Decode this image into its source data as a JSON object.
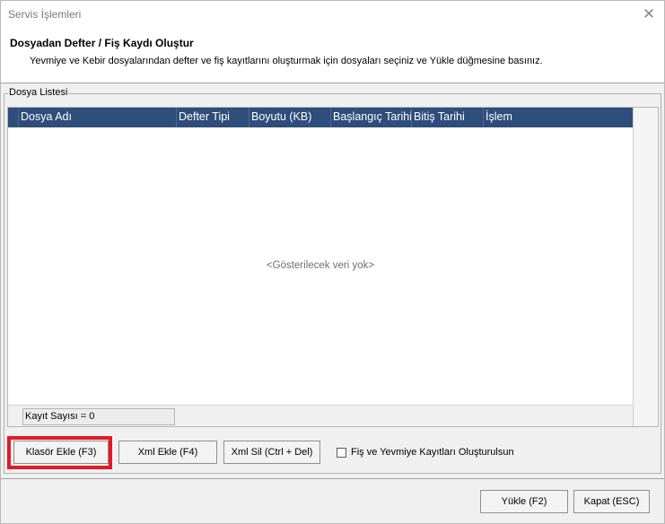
{
  "window": {
    "title": "Servis İşlemleri",
    "close_symbol": "✕"
  },
  "header": {
    "title": "Dosyadan Defter / Fiş Kaydı Oluştur",
    "description": "Yevmiye ve Kebir dosyalarından defter ve fiş kayıtlarını oluşturmak için dosyaları seçiniz ve Yükle düğmesine basınız."
  },
  "file_list": {
    "group_label": "Dosya Listesi",
    "columns": [
      "Dosya Adı",
      "Defter Tipi",
      "Boyutu (KB)",
      "Başlangıç Tarihi",
      "Bitiş Tarihi",
      "İşlem"
    ],
    "empty_message": "<Gösterilecek veri yok>",
    "record_count": "Kayıt Sayısı = 0",
    "header_color": "#2e4d7b"
  },
  "actions": {
    "add_folder": "Klasör Ekle (F3)",
    "add_xml": "Xml Ekle (F4)",
    "delete_xml": "Xml Sil (Ctrl + Del)",
    "create_records_checkbox": "Fiş ve Yevmiye Kayıtları Oluşturulsun",
    "create_records_checked": false
  },
  "footer": {
    "load": "Yükle (F2)",
    "close": "Kapat (ESC)"
  },
  "highlight_color": "#e21b25"
}
